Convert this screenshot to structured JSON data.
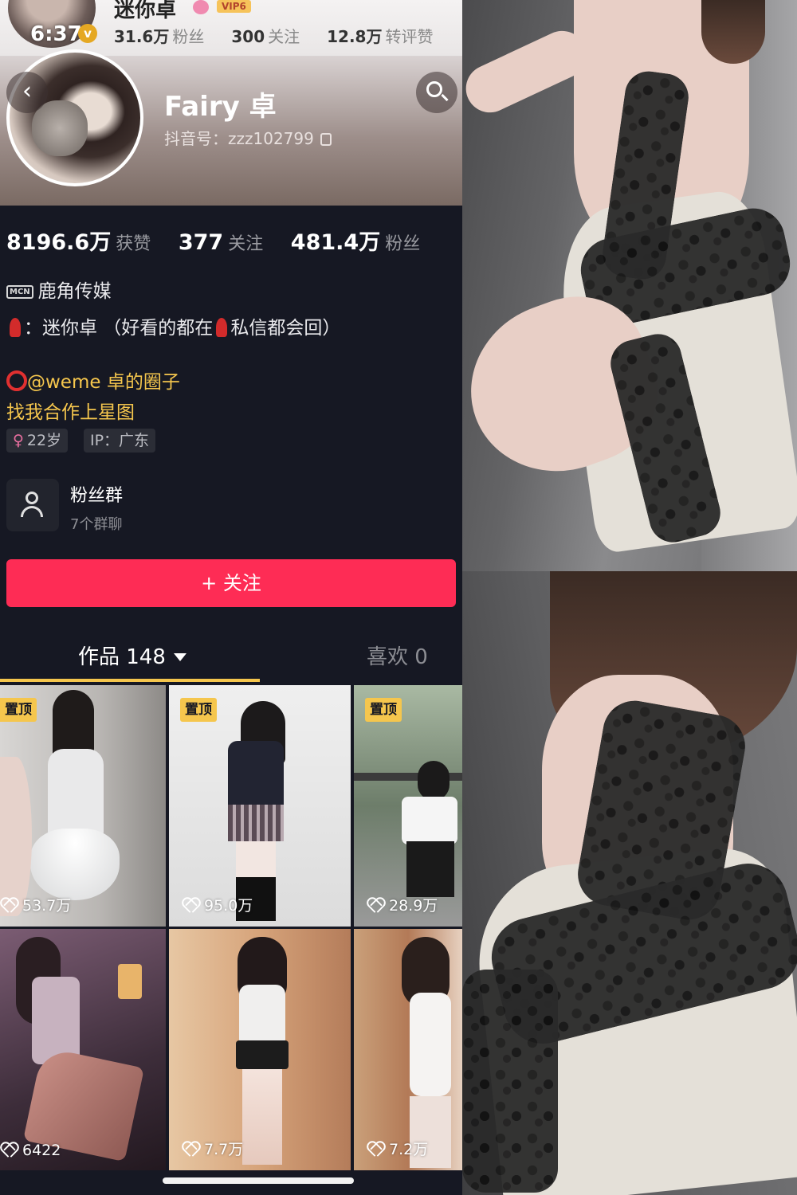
{
  "top_bar": {
    "time": "6:37",
    "name": "迷你卓",
    "vip": "VIP6",
    "stats": [
      {
        "num": "31.6万",
        "label": "粉丝"
      },
      {
        "num": "300",
        "label": "关注"
      },
      {
        "num": "12.8万",
        "label": "转评赞"
      }
    ]
  },
  "profile": {
    "nickname": "Fairy 卓",
    "account_id": "抖音号：zzz102799",
    "stats": [
      {
        "num": "8196.6万",
        "label": "获赞"
      },
      {
        "num": "377",
        "label": "关注"
      },
      {
        "num": "481.4万",
        "label": "粉丝"
      }
    ],
    "mcn_badge": "MCN",
    "mcn": "鹿角传媒",
    "bio_1": "：迷你卓 （好看的都在",
    "bio_2": "私信都会回）",
    "mention": "@weme 卓的圈子",
    "cooperation": "找我合作上星图",
    "tags": {
      "age_icon": "♀",
      "age": "22岁",
      "ip": "IP：广东"
    },
    "fan_group": {
      "title": "粉丝群",
      "subtitle": "7个群聊"
    }
  },
  "follow_button": "+ 关注",
  "tabs": {
    "works": "作品 148",
    "likes": "喜欢 0"
  },
  "pin_label": "置顶",
  "videos": [
    {
      "likes": "53.7万",
      "pinned": true
    },
    {
      "likes": "95.0万",
      "pinned": true
    },
    {
      "likes": "28.9万",
      "pinned": true
    },
    {
      "likes": "6422",
      "pinned": false
    },
    {
      "likes": "7.7万",
      "pinned": false
    },
    {
      "likes": "7.2万",
      "pinned": false
    }
  ],
  "colors": {
    "accent": "#fe2c55",
    "highlight": "#f5c64d",
    "background": "#161823"
  }
}
